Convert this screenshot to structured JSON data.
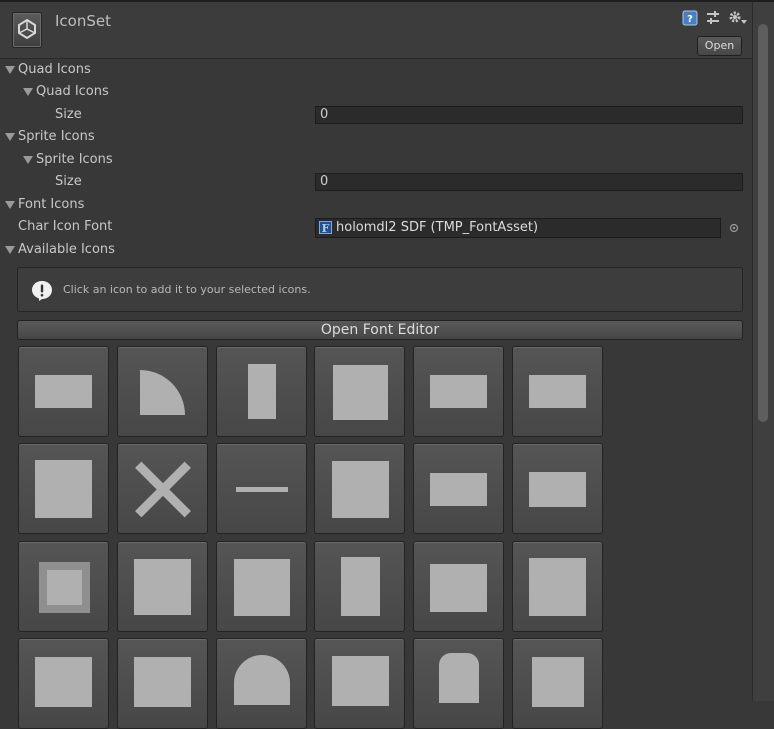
{
  "header": {
    "title": "IconSet",
    "open_label": "Open"
  },
  "sections": {
    "quad_icons": "Quad Icons",
    "quad_icons_inner": "Quad Icons",
    "quad_size_label": "Size",
    "quad_size_value": "0",
    "sprite_icons": "Sprite Icons",
    "sprite_icons_inner": "Sprite Icons",
    "sprite_size_label": "Size",
    "sprite_size_value": "0",
    "font_icons": "Font Icons",
    "char_icon_font_label": "Char Icon Font",
    "char_icon_font_value": "holomdl2 SDF (TMP_FontAsset)",
    "available_icons": "Available Icons"
  },
  "help": {
    "text": "Click an icon to add it to your selected icons."
  },
  "open_font_editor_label": "Open Font Editor",
  "icon_grid": {
    "columns": 6,
    "icons": [
      "horizontal-bar-icon",
      "wifi-arc-icon",
      "bluetooth-icon",
      "sun-icon",
      "mail-icon",
      "mail-open-icon",
      "square-icon",
      "close-x-icon",
      "minus-icon",
      "gear-icon",
      "landscape-rect-icon",
      "double-rect-icon",
      "framed-square-icon",
      "lines-square-icon",
      "search-icon",
      "microphone-icon",
      "camera-icon",
      "star-icon",
      "tile-icon-19",
      "tile-icon-20",
      "tile-icon-21",
      "tile-icon-22",
      "lock-icon",
      "pause-icon"
    ]
  },
  "colors": {
    "background": "#383838",
    "header": "#3c3c3c",
    "field": "#2b2b2b",
    "tile": "#4e4e4e",
    "accent": "#2a4f86"
  }
}
